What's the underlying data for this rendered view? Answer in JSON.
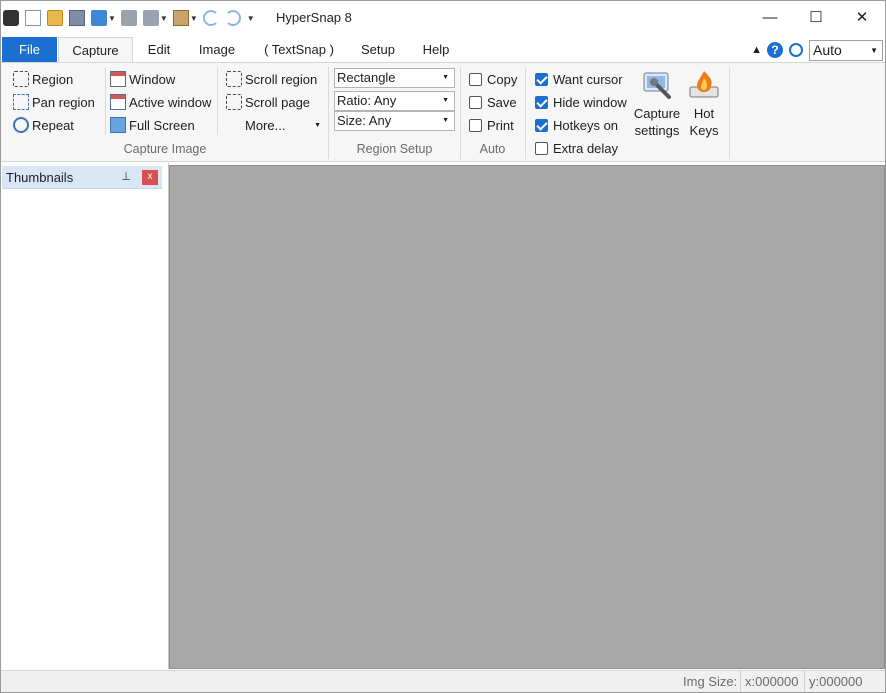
{
  "titlebar": {
    "title": "HyperSnap 8",
    "qat_icons": [
      "camera-icon",
      "new-document-icon",
      "open-folder-icon",
      "save-icon",
      "upload-icon",
      "print-icon",
      "print-multiple-icon",
      "clipboard-icon",
      "undo-icon",
      "redo-icon"
    ]
  },
  "window_controls": {
    "minimize": "—",
    "maximize": "☐",
    "close": "✕"
  },
  "tabs": [
    {
      "label": "File"
    },
    {
      "label": "Capture"
    },
    {
      "label": "Edit"
    },
    {
      "label": "Image"
    },
    {
      "label": "( TextSnap )"
    },
    {
      "label": "Setup"
    },
    {
      "label": "Help"
    }
  ],
  "right_tools": {
    "zoom_value": "Auto"
  },
  "ribbon": {
    "capture_image": {
      "label": "Capture Image",
      "col1": [
        "Region",
        "Pan region",
        "Repeat"
      ],
      "col2": [
        "Window",
        "Active window",
        "Full Screen"
      ],
      "col3": [
        "Scroll region",
        "Scroll page",
        "More..."
      ]
    },
    "region_setup": {
      "label": "Region Setup",
      "shape": "Rectangle",
      "ratio": "Ratio: Any",
      "size": "Size: Any"
    },
    "auto": {
      "label": "Auto",
      "copy": "Copy",
      "save": "Save",
      "print": "Print"
    },
    "options": {
      "want_cursor": "Want cursor",
      "hide_window": "Hide window",
      "hotkeys_on": "Hotkeys on",
      "extra_delay": "Extra delay",
      "want_cursor_checked": true,
      "hide_window_checked": true,
      "hotkeys_on_checked": true,
      "extra_delay_checked": false
    },
    "capture_settings": {
      "line1": "Capture",
      "line2": "settings"
    },
    "hot_keys": {
      "line1": "Hot",
      "line2": "Keys"
    }
  },
  "thumbnails": {
    "title": "Thumbnails",
    "close": "x"
  },
  "status": {
    "img_size_label": "Img Size:",
    "x": "x:000000",
    "y": "y:000000"
  },
  "colors": {
    "accent": "#1a6fd1",
    "canvas": "#a8a8a8",
    "panel_header": "#d9e6f5",
    "close_red": "#d94f4f"
  }
}
